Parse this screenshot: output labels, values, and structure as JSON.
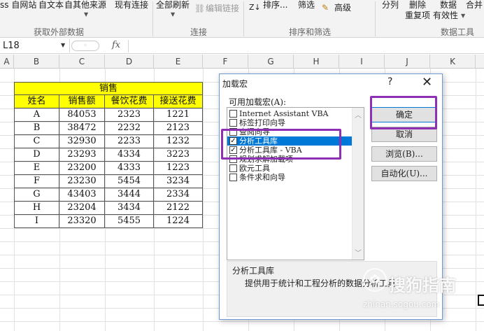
{
  "ribbon": {
    "btn_web": "ss 自网站",
    "btn_text": "自文本",
    "btn_other": "自其他来源",
    "btn_existing": "现有连接",
    "btn_refresh": "全部刷新",
    "btn_edit_links": "编辑链接",
    "btn_sort": "排序...",
    "btn_filter": "筛选",
    "btn_advanced": "高级",
    "btn_split": "分列",
    "btn_remove": "删除",
    "btn_remove2": "重复项",
    "btn_data": "数据",
    "btn_validity": "有效性",
    "btn_merge": "合并",
    "groups": [
      "获取外部数据",
      "连接",
      "排序和筛选",
      "数据工具"
    ]
  },
  "formula_bar": {
    "name_box": "L18",
    "fx": "fx"
  },
  "columns": [
    "A",
    "B",
    "C",
    "D",
    "E",
    "F",
    "G",
    "H",
    "I",
    "J",
    "K"
  ],
  "sales_table": {
    "group_header": "销售",
    "headers": [
      "姓名",
      "销售额",
      "餐饮花费",
      "接送花费"
    ],
    "rows": [
      [
        "A",
        "84053",
        "2323",
        "1221"
      ],
      [
        "B",
        "38472",
        "2232",
        "2123"
      ],
      [
        "C",
        "32930",
        "2233",
        "1232"
      ],
      [
        "D",
        "23293",
        "4334",
        "3223"
      ],
      [
        "E",
        "23200",
        "4333",
        "1223"
      ],
      [
        "F",
        "23230",
        "5454",
        "3234"
      ],
      [
        "G",
        "43403",
        "3444",
        "2334"
      ],
      [
        "H",
        "23204",
        "3434",
        "2122"
      ],
      [
        "I",
        "23320",
        "5455",
        "1224"
      ]
    ]
  },
  "dialog": {
    "title": "加载宏",
    "help": "?",
    "close": "✕",
    "caption": "可用加载宏(A):",
    "addins": [
      {
        "label": "Internet Assistant VBA",
        "checked": false,
        "selected": false
      },
      {
        "label": "标签打印向导",
        "checked": false,
        "selected": false
      },
      {
        "label": "查阅向导",
        "checked": false,
        "selected": false
      },
      {
        "label": "分析工具库",
        "checked": true,
        "selected": true
      },
      {
        "label": "分析工具库 - VBA",
        "checked": true,
        "selected": false
      },
      {
        "label": "规划求解加载项",
        "checked": false,
        "selected": false
      },
      {
        "label": "欧元工具",
        "checked": false,
        "selected": false
      },
      {
        "label": "条件求和向导",
        "checked": false,
        "selected": false
      }
    ],
    "buttons": {
      "ok": "确定",
      "cancel": "取消",
      "browse": "浏览(B)...",
      "automation": "自动化(U)..."
    },
    "desc_title": "分析工具库",
    "desc_text": "提供用于统计和工程分析的数据分析工具"
  },
  "watermark": {
    "text": "搜狗指南",
    "url": "zhinan.sogou.com"
  },
  "colors": {
    "highlight": "#8f2fb3",
    "table_header": "#ffff00",
    "selection": "#0078d7"
  }
}
